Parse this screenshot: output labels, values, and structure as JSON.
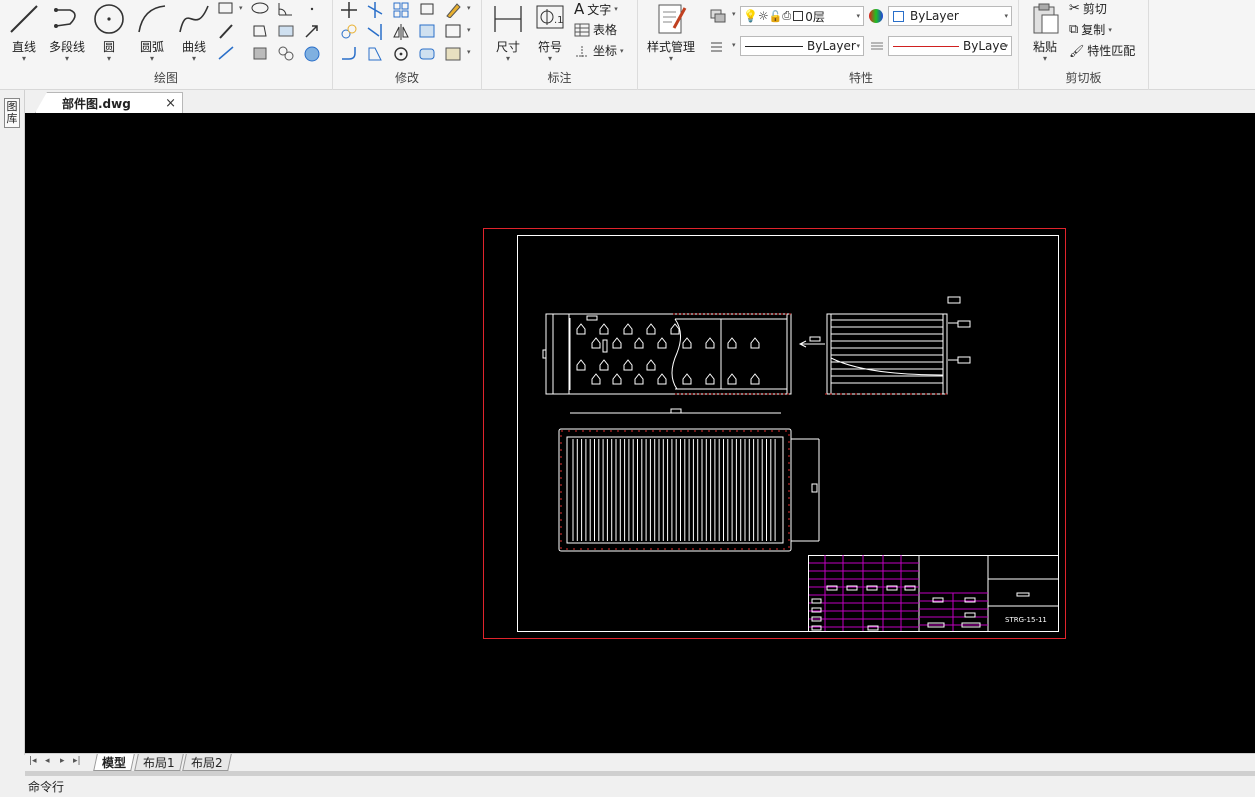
{
  "document": {
    "tab_title": "部件图.dwg",
    "close_glyph": "×"
  },
  "ribbon": {
    "draw": {
      "label": "绘图",
      "tools": [
        "直线",
        "多段线",
        "圆",
        "圆弧",
        "曲线"
      ]
    },
    "modify": {
      "label": "修改"
    },
    "annotate": {
      "label": "标注",
      "dimension": "尺寸",
      "symbol": "符号",
      "text": "文字",
      "table": "表格",
      "coordinate": "坐标"
    },
    "style": {
      "label": "样式管理"
    },
    "properties": {
      "label": "特性",
      "layer_value": "0层",
      "color_value": "ByLayer",
      "linetype_value": "ByLayer",
      "lineweight_value": "ByLaye"
    },
    "clipboard": {
      "label": "剪切板",
      "paste": "粘贴",
      "cut": "剪切",
      "copy": "复制",
      "match": "特性匹配"
    }
  },
  "side_panel": {
    "label": "图库"
  },
  "layout_tabs": [
    "模型",
    "布局1",
    "布局2"
  ],
  "command_line": {
    "label": "命令行"
  },
  "drawing": {
    "title_block_code": "STRG-15-11"
  },
  "colors": {
    "canvas": "#000000",
    "frame": "#e0242c",
    "table": "#c000c0",
    "hatch_marks": "#e03030"
  }
}
